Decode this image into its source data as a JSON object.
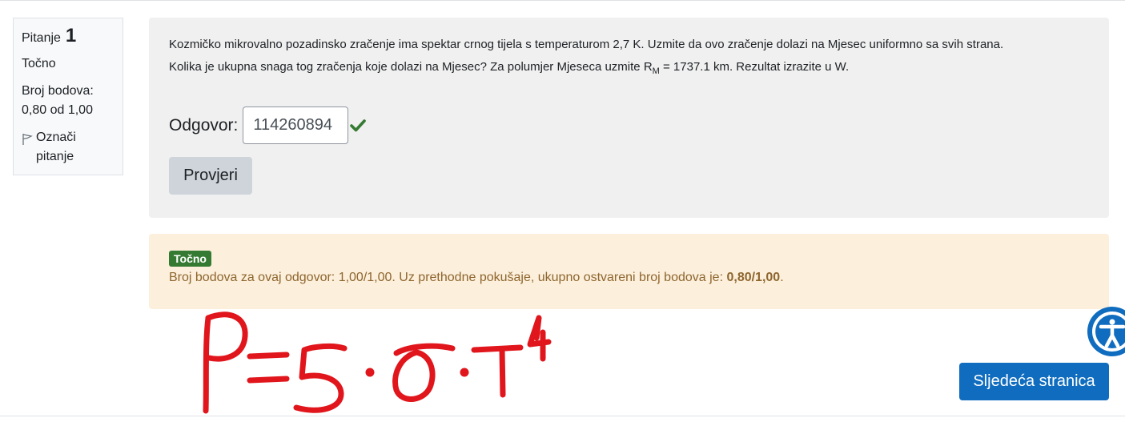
{
  "info": {
    "question_label": "Pitanje",
    "question_number": "1",
    "state": "Točno",
    "grade_line1": "Broj bodova:",
    "grade_line2": "0,80 od 1,00",
    "flag_label_1": "Označi",
    "flag_label_2": "pitanje"
  },
  "question": {
    "text_line1": "Kozmičko mikrovalno pozadinsko zračenje ima spektar crnog tijela s temperaturom 2,7 K. Uzmite da ovo zračenje dolazi na Mjesec uniformno sa svih strana.",
    "text_line2_a": "Kolika je ukupna snaga tog zračenja koje dolazi na Mjesec? Za polumjer Mjeseca uzmite R",
    "text_line2_sub": "M",
    "text_line2_b": " = 1737.1 km. Rezultat izrazite u W.",
    "answer_label": "Odgovor:",
    "answer_value": "114260894",
    "check_button": "Provjeri"
  },
  "feedback": {
    "badge": "Točno",
    "text": "Broj bodova za ovaj odgovor: 1,00/1,00. Uz prethodne pokušaje, ukupno ostvareni broj bodova je: ",
    "total": "0,80/1,00",
    "period": "."
  },
  "handwriting_formula": "P = S · σ · T⁴",
  "next_button": "Sljedeća stranica",
  "colors": {
    "correct_green": "#357a32",
    "primary_blue": "#0f6cbf",
    "feedback_bg": "#fcefdc",
    "handwriting_red": "#e0161c"
  },
  "icons": [
    "flag-icon",
    "check-icon",
    "accessibility-icon"
  ]
}
